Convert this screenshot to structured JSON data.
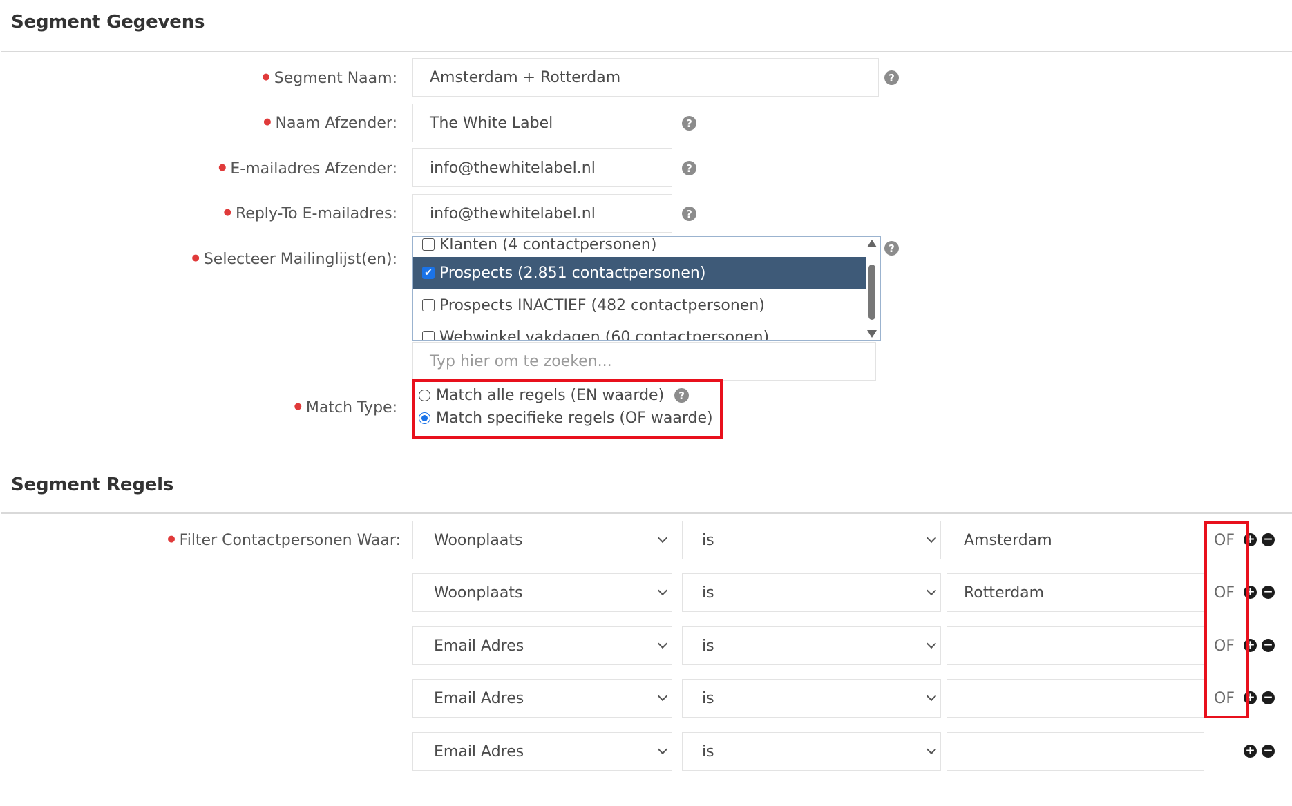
{
  "segment_details": {
    "title": "Segment Gegevens",
    "fields": {
      "segment_name": {
        "label": "Segment Naam:",
        "value": "Amsterdam + Rotterdam"
      },
      "sender_name": {
        "label": "Naam Afzender:",
        "value": "The White Label"
      },
      "sender_email": {
        "label": "E-mailadres Afzender:",
        "value": "info@thewhitelabel.nl"
      },
      "reply_to": {
        "label": "Reply-To E-mailadres:",
        "value": "info@thewhitelabel.nl"
      }
    },
    "mailing_lists": {
      "label": "Selecteer Mailinglijst(en):",
      "items": [
        {
          "label": "Klanten (4 contactpersonen)",
          "checked": false
        },
        {
          "label": "Prospects (2.851 contactpersonen)",
          "checked": true
        },
        {
          "label": "Prospects INACTIEF (482 contactpersonen)",
          "checked": false
        },
        {
          "label": "Webwinkel vakdagen (60 contactpersonen)",
          "checked": false
        }
      ],
      "search_placeholder": "Typ hier om te zoeken..."
    },
    "match_type": {
      "label": "Match Type:",
      "options": [
        {
          "label": "Match alle regels (EN waarde)",
          "selected": false
        },
        {
          "label": "Match specifieke regels (OF waarde)",
          "selected": true
        }
      ]
    }
  },
  "segment_rules": {
    "title": "Segment Regels",
    "filter_label": "Filter Contactpersonen Waar:",
    "rows": [
      {
        "field": "Woonplaats",
        "operator": "is",
        "value": "Amsterdam",
        "connector": "OF"
      },
      {
        "field": "Woonplaats",
        "operator": "is",
        "value": "Rotterdam",
        "connector": "OF"
      },
      {
        "field": "Email Adres",
        "operator": "is",
        "value": "",
        "connector": "OF"
      },
      {
        "field": "Email Adres",
        "operator": "is",
        "value": "",
        "connector": "OF"
      },
      {
        "field": "Email Adres",
        "operator": "is",
        "value": "",
        "connector": ""
      }
    ],
    "add_symbol": "+",
    "remove_symbol": "−"
  },
  "icons": {
    "help": "question-circle-icon",
    "checkmark": "✔"
  },
  "colors": {
    "highlight": "#e8101c",
    "selected_row": "#3e5a78",
    "required": "#e03a3a"
  }
}
